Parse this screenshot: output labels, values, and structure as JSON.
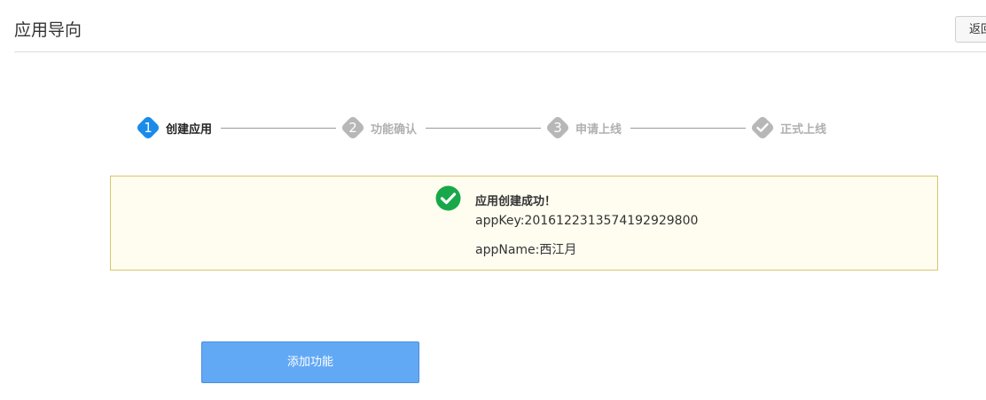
{
  "header": {
    "title": "应用导向",
    "back_label": "返回"
  },
  "steps": [
    {
      "number": "1",
      "label": "创建应用",
      "state": "active",
      "icon": "number"
    },
    {
      "number": "2",
      "label": "功能确认",
      "state": "pending",
      "icon": "number"
    },
    {
      "number": "3",
      "label": "申请上线",
      "state": "pending",
      "icon": "number"
    },
    {
      "number": "",
      "label": "正式上线",
      "state": "pending",
      "icon": "check-icon"
    }
  ],
  "result": {
    "icon": "check-circle-icon",
    "icon_color": "#18a84a",
    "title": "应用创建成功！",
    "app_key": "appKey:20161223135741929298​00",
    "app_name": "appName:西江月"
  },
  "actions": {
    "add_feature_label": "添加功能"
  },
  "colors": {
    "accent": "#1a8bea",
    "inactive": "#b7b7b7",
    "button": "#62a9f5",
    "notice_bg": "#fffdf0",
    "notice_border": "#d7c56b"
  }
}
